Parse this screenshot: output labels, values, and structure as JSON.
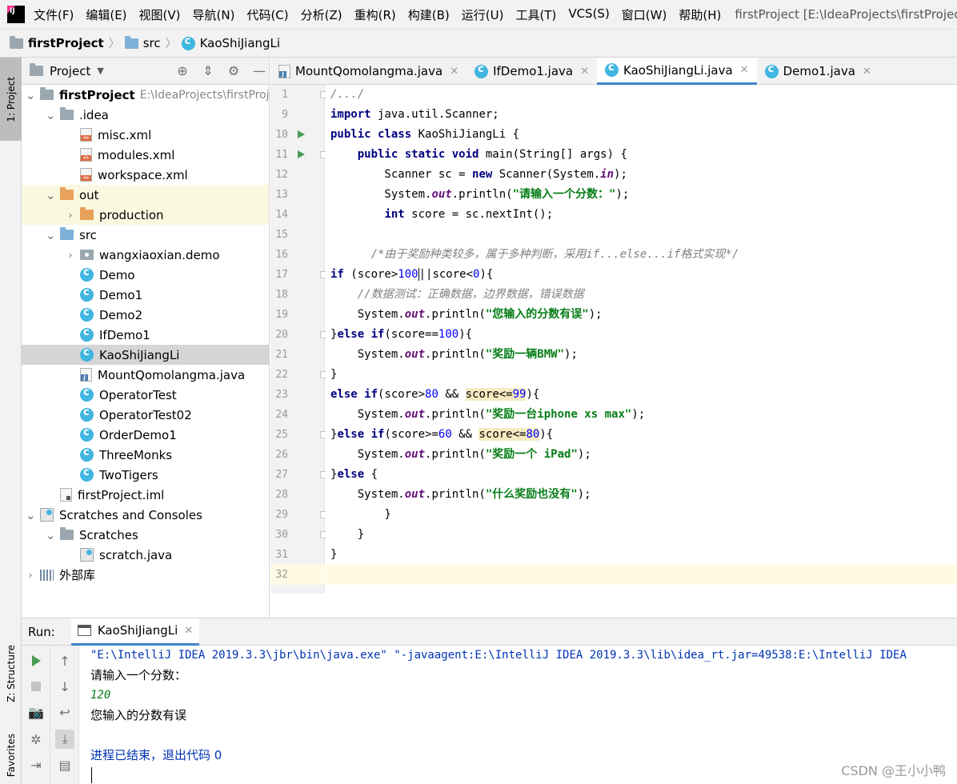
{
  "menu": {
    "items": [
      "文件(F)",
      "编辑(E)",
      "视图(V)",
      "导航(N)",
      "代码(C)",
      "分析(Z)",
      "重构(R)",
      "构建(B)",
      "运行(U)",
      "工具(T)",
      "VCS(S)",
      "窗口(W)",
      "帮助(H)"
    ],
    "window_title": "firstProject [E:\\IdeaProjects\\firstProject] -"
  },
  "breadcrumb": [
    "firstProject",
    "src",
    "KaoShiJiangLi"
  ],
  "left_strip": {
    "project": "1: Project",
    "structure": "Z: Structure",
    "favorites": "Favorites"
  },
  "project_panel": {
    "title": "Project",
    "tree": [
      {
        "indent": 0,
        "arrow": "down",
        "icon": "folder",
        "label": "firstProject",
        "path": "E:\\IdeaProjects\\firstProj",
        "bold": true
      },
      {
        "indent": 1,
        "arrow": "down",
        "icon": "folder",
        "label": ".idea"
      },
      {
        "indent": 2,
        "arrow": "none",
        "icon": "xml",
        "label": "misc.xml"
      },
      {
        "indent": 2,
        "arrow": "none",
        "icon": "xml",
        "label": "modules.xml"
      },
      {
        "indent": 2,
        "arrow": "none",
        "icon": "xml",
        "label": "workspace.xml"
      },
      {
        "indent": 1,
        "arrow": "down",
        "icon": "folder-orange",
        "label": "out",
        "tinted": true
      },
      {
        "indent": 2,
        "arrow": "right",
        "icon": "folder-orange",
        "label": "production",
        "tinted": true
      },
      {
        "indent": 1,
        "arrow": "down",
        "icon": "folder-blue",
        "label": "src"
      },
      {
        "indent": 2,
        "arrow": "right",
        "icon": "package",
        "label": "wangxiaoxian.demo"
      },
      {
        "indent": 2,
        "arrow": "none",
        "icon": "class",
        "label": "Demo"
      },
      {
        "indent": 2,
        "arrow": "none",
        "icon": "class",
        "label": "Demo1"
      },
      {
        "indent": 2,
        "arrow": "none",
        "icon": "class",
        "label": "Demo2"
      },
      {
        "indent": 2,
        "arrow": "none",
        "icon": "class",
        "label": "IfDemo1"
      },
      {
        "indent": 2,
        "arrow": "none",
        "icon": "class",
        "label": "KaoShiJiangLi",
        "selected": true
      },
      {
        "indent": 2,
        "arrow": "none",
        "icon": "java",
        "label": "MountQomolangma.java"
      },
      {
        "indent": 2,
        "arrow": "none",
        "icon": "class",
        "label": "OperatorTest"
      },
      {
        "indent": 2,
        "arrow": "none",
        "icon": "class",
        "label": "OperatorTest02"
      },
      {
        "indent": 2,
        "arrow": "none",
        "icon": "class",
        "label": "OrderDemo1"
      },
      {
        "indent": 2,
        "arrow": "none",
        "icon": "class",
        "label": "ThreeMonks"
      },
      {
        "indent": 2,
        "arrow": "none",
        "icon": "class",
        "label": "TwoTigers"
      },
      {
        "indent": 1,
        "arrow": "none",
        "icon": "iml",
        "label": "firstProject.iml"
      },
      {
        "indent": 0,
        "arrow": "down",
        "icon": "scratch",
        "label": "Scratches and Consoles"
      },
      {
        "indent": 1,
        "arrow": "down",
        "icon": "folder",
        "label": "Scratches"
      },
      {
        "indent": 2,
        "arrow": "none",
        "icon": "scratch",
        "label": "scratch.java"
      },
      {
        "indent": 0,
        "arrow": "right",
        "icon": "libs",
        "label": "外部库"
      }
    ]
  },
  "editor": {
    "tabs": [
      {
        "icon": "java",
        "label": "MountQomolangma.java"
      },
      {
        "icon": "class",
        "label": "IfDemo1.java"
      },
      {
        "icon": "class",
        "label": "KaoShiJiangLi.java",
        "active": true
      },
      {
        "icon": "class",
        "label": "Demo1.java"
      }
    ],
    "lines": [
      {
        "n": "1",
        "fold": true,
        "html": "<span class='cmt'>/.../</span>"
      },
      {
        "n": "9",
        "html": "<span class='kw'>import</span> java.util.Scanner;"
      },
      {
        "n": "10",
        "run": true,
        "html": "<span class='kw'>public class</span> KaoShiJiangLi {"
      },
      {
        "n": "11",
        "run": true,
        "fold": true,
        "html": "    <span class='kw'>public static void</span> main(String[] args) {"
      },
      {
        "n": "12",
        "html": "        Scanner sc = <span class='kw'>new</span> Scanner(System.<span class='fld'>in</span>);"
      },
      {
        "n": "13",
        "html": "        System.<span class='fld'>out</span>.println(<span class='str'>\"请输入一个分数：\"</span>);"
      },
      {
        "n": "14",
        "html": "        <span class='kw'>int</span> score = sc.nextInt();"
      },
      {
        "n": "15",
        "html": ""
      },
      {
        "n": "16",
        "html": "      <span class='cmt'>/*由于奖励种类较多，属于多种判断，采用if...else...if格式实现*/</span>"
      },
      {
        "n": "17",
        "fold": true,
        "html": "<span class='kw'>if</span> (score&gt;<span class='num-lit'>100</span><span class='caret-mark'></span>||score&lt;<span class='num-lit'>0</span>){"
      },
      {
        "n": "18",
        "html": "    <span class='cmt'>//数据测试：正确数据，边界数据，错误数据</span>"
      },
      {
        "n": "19",
        "html": "    System.<span class='fld'>out</span>.println(<span class='str'>\"您输入的分数有误\"</span>);"
      },
      {
        "n": "20",
        "fold": true,
        "html": "}<span class='kw'>else if</span>(score==<span class='num-lit'>100</span>){"
      },
      {
        "n": "21",
        "html": "    System.<span class='fld'>out</span>.println(<span class='str'>\"奖励一辆BMW\"</span>);"
      },
      {
        "n": "22",
        "fold": true,
        "html": "}"
      },
      {
        "n": "23",
        "html": "<span class='kw'>else if</span>(score&gt;<span class='num-lit'>80</span> &amp;&amp; <span class='hl'>score&lt;=</span><span class='num-lit hl'>99</span>){"
      },
      {
        "n": "24",
        "html": "    System.<span class='fld'>out</span>.println(<span class='str'>\"奖励一台iphone xs max\"</span>);"
      },
      {
        "n": "25",
        "fold": true,
        "html": "}<span class='kw'>else if</span>(score&gt;=<span class='num-lit'>60</span> &amp;&amp; <span class='hl'>score&lt;=</span><span class='num-lit hl'>80</span>){"
      },
      {
        "n": "26",
        "html": "    System.<span class='fld'>out</span>.println(<span class='str'>\"奖励一个 iPad\"</span>);"
      },
      {
        "n": "27",
        "fold": true,
        "html": "}<span class='kw'>else</span> {"
      },
      {
        "n": "28",
        "html": "    System.<span class='fld'>out</span>.println(<span class='str'>\"什么奖励也没有\"</span>);"
      },
      {
        "n": "29",
        "fold": true,
        "html": "        }"
      },
      {
        "n": "30",
        "fold": true,
        "html": "    }"
      },
      {
        "n": "31",
        "html": "}"
      },
      {
        "n": "32",
        "current": true,
        "html": ""
      }
    ]
  },
  "run": {
    "label": "Run:",
    "tab": "KaoShiJiangLi",
    "console": [
      {
        "kind": "cmd",
        "text": "\"E:\\IntelliJ IDEA 2019.3.3\\jbr\\bin\\java.exe\" \"-javaagent:E:\\IntelliJ IDEA 2019.3.3\\lib\\idea_rt.jar=49538:E:\\IntelliJ IDEA"
      },
      {
        "kind": "out",
        "text": "请输入一个分数："
      },
      {
        "kind": "input",
        "text": "120"
      },
      {
        "kind": "out",
        "text": "您输入的分数有误"
      },
      {
        "kind": "blank",
        "text": ""
      },
      {
        "kind": "exit",
        "text": "进程已结束，退出代码 0"
      }
    ]
  },
  "watermark": "CSDN @王小小鸭"
}
